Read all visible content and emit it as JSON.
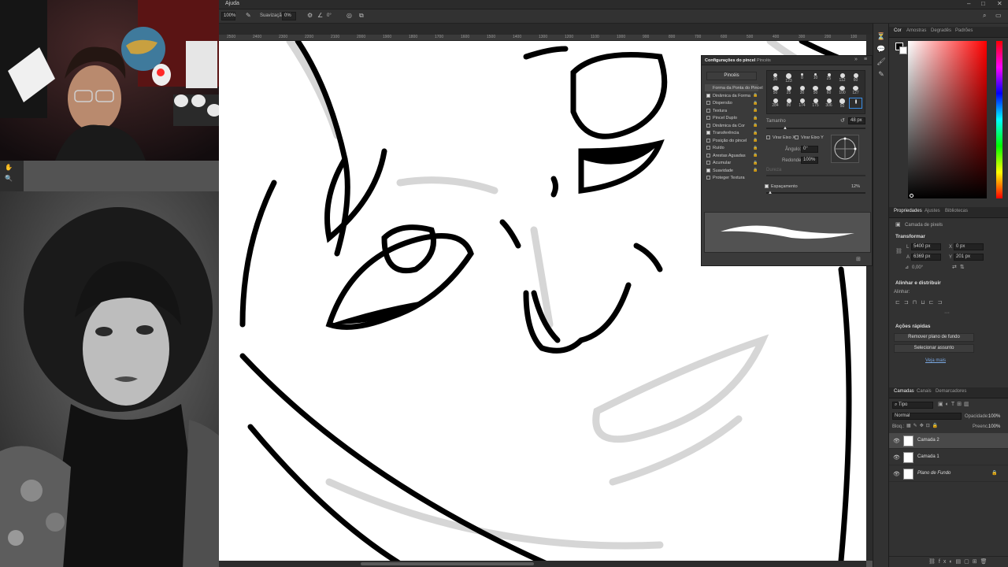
{
  "menubar": {
    "item": "Ajuda",
    "win_min": "–",
    "win_max": "□",
    "win_close": "✕"
  },
  "options": {
    "zoom": "100%",
    "smoothing_label": "Suavização:",
    "smoothing_value": "0%",
    "angle": "0°"
  },
  "ruler": {
    "ticks": [
      "2500",
      "2400",
      "2300",
      "2200",
      "2100",
      "2000",
      "1900",
      "1800",
      "1700",
      "1600",
      "1500",
      "1400",
      "1300",
      "1200",
      "1100",
      "1000",
      "900",
      "800",
      "700",
      "600",
      "500",
      "400",
      "300",
      "200",
      "100"
    ]
  },
  "brush_panel": {
    "title": "Configurações do pincel",
    "tab2": "Pincéis",
    "brushes_button": "Pincéis",
    "options": [
      {
        "label": "Forma da Ponta do Pincel",
        "checked": false,
        "selected": true
      },
      {
        "label": "Dinâmica da Forma",
        "checked": true
      },
      {
        "label": "Dispersão",
        "checked": false
      },
      {
        "label": "Textura",
        "checked": false
      },
      {
        "label": "Pincel Duplo",
        "checked": false
      },
      {
        "label": "Dinâmica da Cor",
        "checked": false
      },
      {
        "label": "Transferência",
        "checked": true
      },
      {
        "label": "Posição do pincel",
        "checked": false
      },
      {
        "label": "Ruído",
        "checked": false
      },
      {
        "label": "Arestas Aguadas",
        "checked": false
      },
      {
        "label": "Acumular",
        "checked": false
      },
      {
        "label": "Suavidade",
        "checked": true
      },
      {
        "label": "Proteger Textura",
        "checked": false
      }
    ],
    "tip_sizes": [
      "30",
      "123",
      "8",
      "10",
      "25",
      "112",
      "60",
      "50",
      "25",
      "30",
      "50",
      "60",
      "100",
      "127",
      "284",
      "80",
      "174",
      "175",
      "306",
      "50",
      ""
    ],
    "size_label": "Tamanho",
    "size_value": "48 px",
    "flip_x": "Virar Eixo X",
    "flip_y": "Virar Eixo Y",
    "angle_label": "Ângulo:",
    "angle_value": "0°",
    "roundness_label": "Redondez:",
    "roundness_value": "100%",
    "hardness_label": "Dureza",
    "spacing_label": "Espaçamento",
    "spacing_value": "12%"
  },
  "color_panel": {
    "tabs": [
      "Cor",
      "Amostras",
      "Degradês",
      "Padrões"
    ]
  },
  "properties": {
    "tabs": [
      "Propriedades",
      "Ajustes",
      "Bibliotecas"
    ],
    "layer_type": "Camada de pixels",
    "transform_title": "Transformar",
    "w_label": "L",
    "w_value": "5400 px",
    "h_label": "A",
    "h_value": "6369 px",
    "x_label": "X",
    "x_value": "0 px",
    "y_label": "Y",
    "y_value": "201 px",
    "rot_value": "0,00°",
    "align_title": "Alinhar e distribuir",
    "align_label": "Alinhar:",
    "quick_title": "Ações rápidas",
    "quick_btn1": "Remover plano de fundo",
    "quick_btn2": "Selecionar assunto",
    "more_link": "Veja mais"
  },
  "layers": {
    "tabs": [
      "Camadas",
      "Canais",
      "Demarcadores"
    ],
    "filter": "Tipo",
    "blend": "Normal",
    "opacity_label": "Opacidade:",
    "opacity_value": "100%",
    "lock_label": "Bloq.:",
    "fill_label": "Preenc.:",
    "fill_value": "100%",
    "items": [
      {
        "name": "Camada 2",
        "selected": true
      },
      {
        "name": "Camada 1",
        "selected": false
      },
      {
        "name": "Plano de Fundo",
        "selected": false
      }
    ]
  }
}
